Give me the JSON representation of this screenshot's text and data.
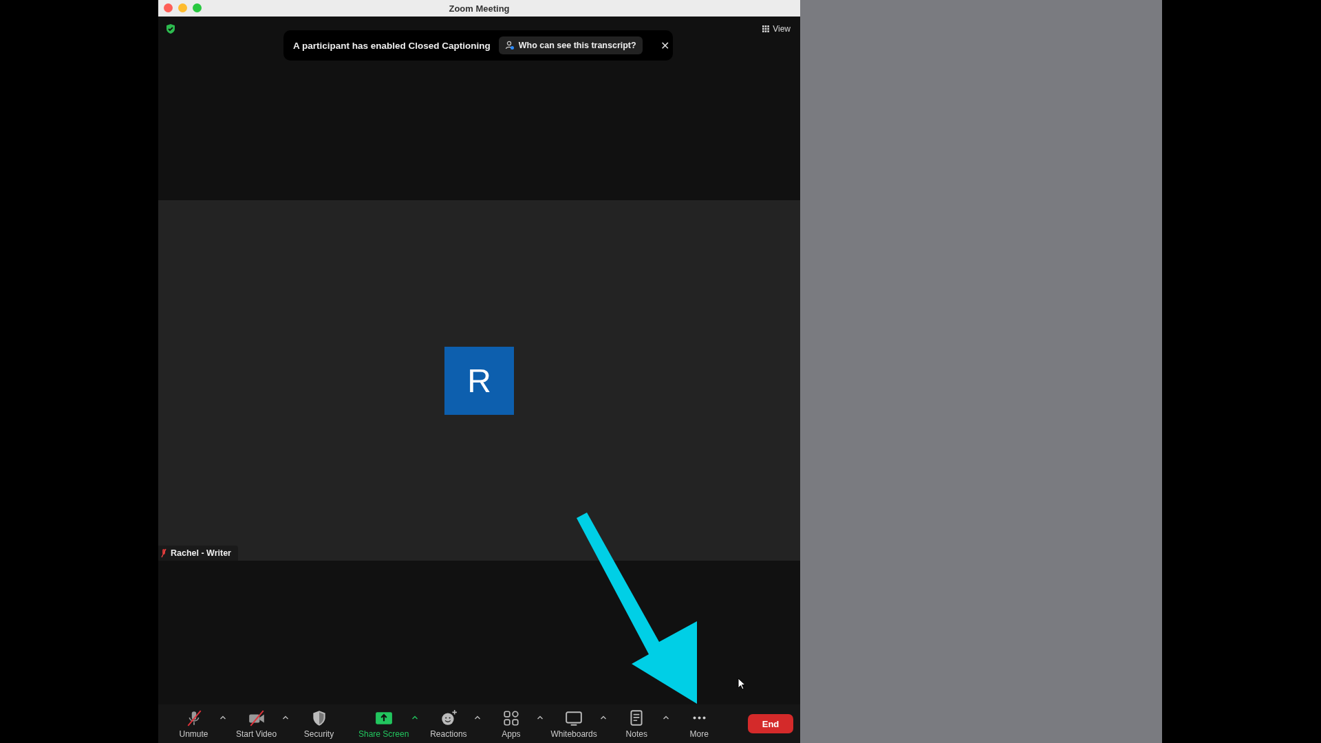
{
  "window": {
    "title": "Zoom Meeting"
  },
  "top_bar": {
    "view_label": "View"
  },
  "notification": {
    "message": "A participant has enabled Closed Captioning",
    "link": "Who can see this transcript?",
    "close": "✕"
  },
  "participant": {
    "initial": "R",
    "name": "Rachel - Writer",
    "muted": true
  },
  "toolbar": [
    {
      "kind": "mic",
      "label": "Unmute",
      "caret": true,
      "off": true,
      "accent": false
    },
    {
      "kind": "video",
      "label": "Start Video",
      "caret": true,
      "off": true,
      "accent": false
    },
    {
      "kind": "security",
      "label": "Security",
      "caret": false,
      "off": false,
      "accent": false
    },
    {
      "kind": "share",
      "label": "Share Screen",
      "caret": true,
      "off": false,
      "accent": true
    },
    {
      "kind": "reactions",
      "label": "Reactions",
      "caret": true,
      "off": false,
      "accent": false
    },
    {
      "kind": "apps",
      "label": "Apps",
      "caret": true,
      "off": false,
      "accent": false
    },
    {
      "kind": "whiteboards",
      "label": "Whiteboards",
      "caret": true,
      "off": false,
      "accent": false
    },
    {
      "kind": "notes",
      "label": "Notes",
      "caret": true,
      "off": false,
      "accent": false
    },
    {
      "kind": "more",
      "label": "More",
      "caret": false,
      "off": false,
      "accent": false
    }
  ],
  "end_button": "End"
}
